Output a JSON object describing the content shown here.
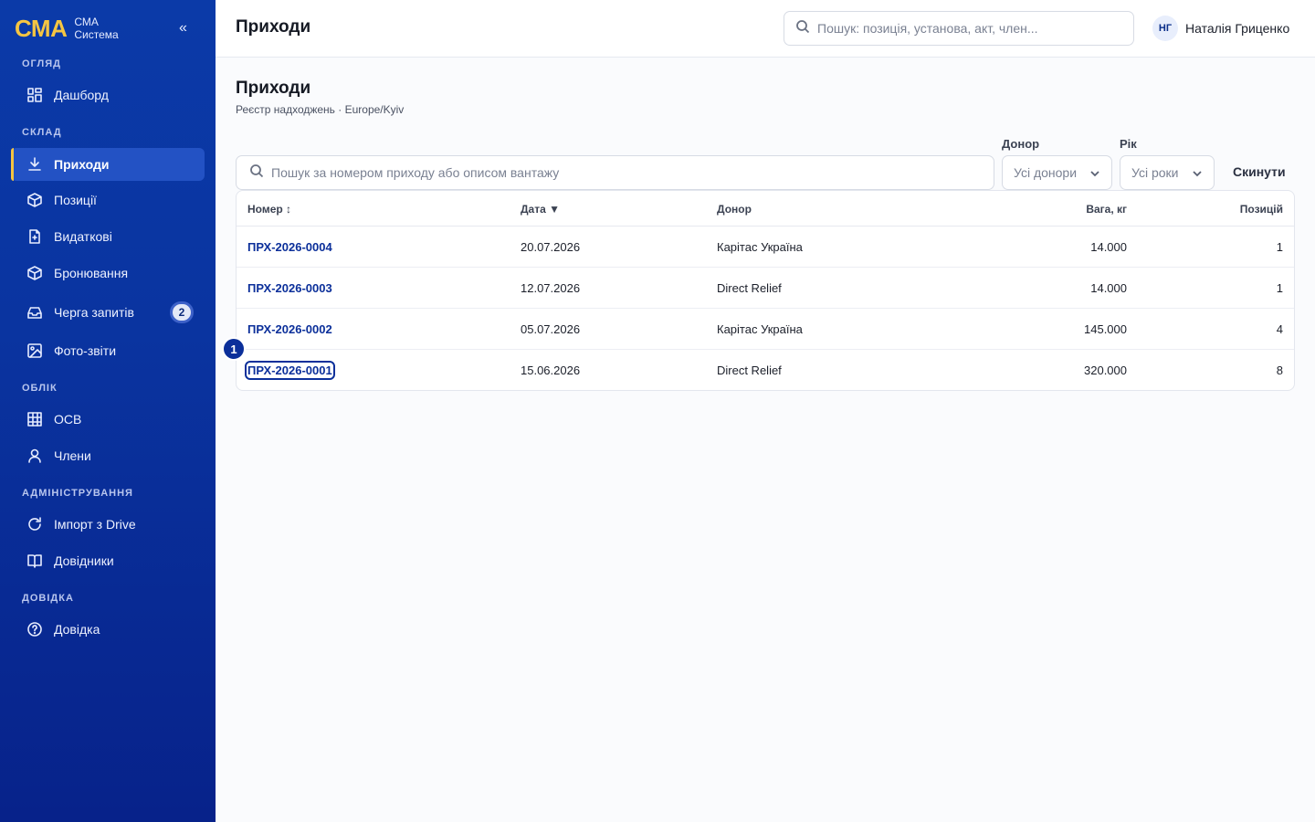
{
  "brand": {
    "logo": "СМА",
    "line1": "СМА",
    "line2": "Система",
    "collapse": "«"
  },
  "sidebar": {
    "sections": [
      {
        "label": "Огляд"
      },
      {
        "label": "Склад"
      },
      {
        "label": "Облік"
      },
      {
        "label": "Адміністрування"
      },
      {
        "label": "Довідка"
      }
    ],
    "items": [
      {
        "label": "Дашборд",
        "icon": "dashboard-icon"
      },
      {
        "label": "Приходи",
        "icon": "download-icon",
        "active": true
      },
      {
        "label": "Позиції",
        "icon": "box-icon"
      },
      {
        "label": "Видаткові",
        "icon": "document-icon"
      },
      {
        "label": "Бронювання",
        "icon": "box-icon"
      },
      {
        "label": "Черга запитів",
        "icon": "inbox-icon",
        "badge": "2"
      },
      {
        "label": "Фото-звіти",
        "icon": "image-icon"
      },
      {
        "label": "ОСВ",
        "icon": "table-icon"
      },
      {
        "label": "Члени",
        "icon": "user-icon"
      },
      {
        "label": "Імпорт з Drive",
        "icon": "refresh-icon"
      },
      {
        "label": "Довідники",
        "icon": "book-icon"
      },
      {
        "label": "Довідка",
        "icon": "help-icon"
      }
    ]
  },
  "header": {
    "title": "Приходи",
    "search_placeholder": "Пошук: позиція, установа, акт, член...",
    "user_initials": "НГ",
    "user_name": "Наталія Гриценко"
  },
  "page": {
    "title": "Приходи",
    "subtitle": "Реєстр надходжень · Europe/Kyiv"
  },
  "filters": {
    "search_placeholder": "Пошук за номером приходу або описом вантажу",
    "donor_label": "Донор",
    "donor_value": "Усі донори",
    "year_label": "Рік",
    "year_value": "Усі роки",
    "reset": "Скинути"
  },
  "table": {
    "columns": [
      "Номер ↕",
      "Дата ▼",
      "Донор",
      "Вага, кг",
      "Позицій"
    ],
    "rows": [
      {
        "number": "ПРХ-2026-0004",
        "date": "20.07.2026",
        "donor": "Карітас Україна",
        "weight": "14.000",
        "items": "1"
      },
      {
        "number": "ПРХ-2026-0003",
        "date": "12.07.2026",
        "donor": "Direct Relief",
        "weight": "14.000",
        "items": "1"
      },
      {
        "number": "ПРХ-2026-0002",
        "date": "05.07.2026",
        "donor": "Карітас Україна",
        "weight": "145.000",
        "items": "4"
      },
      {
        "number": "ПРХ-2026-0001",
        "date": "15.06.2026",
        "donor": "Direct Relief",
        "weight": "320.000",
        "items": "8"
      }
    ]
  },
  "annotation": {
    "marker": "1"
  },
  "colors": {
    "sidebar": "#0a34a0",
    "accent": "#f5c542",
    "link": "#0b2f9a"
  }
}
